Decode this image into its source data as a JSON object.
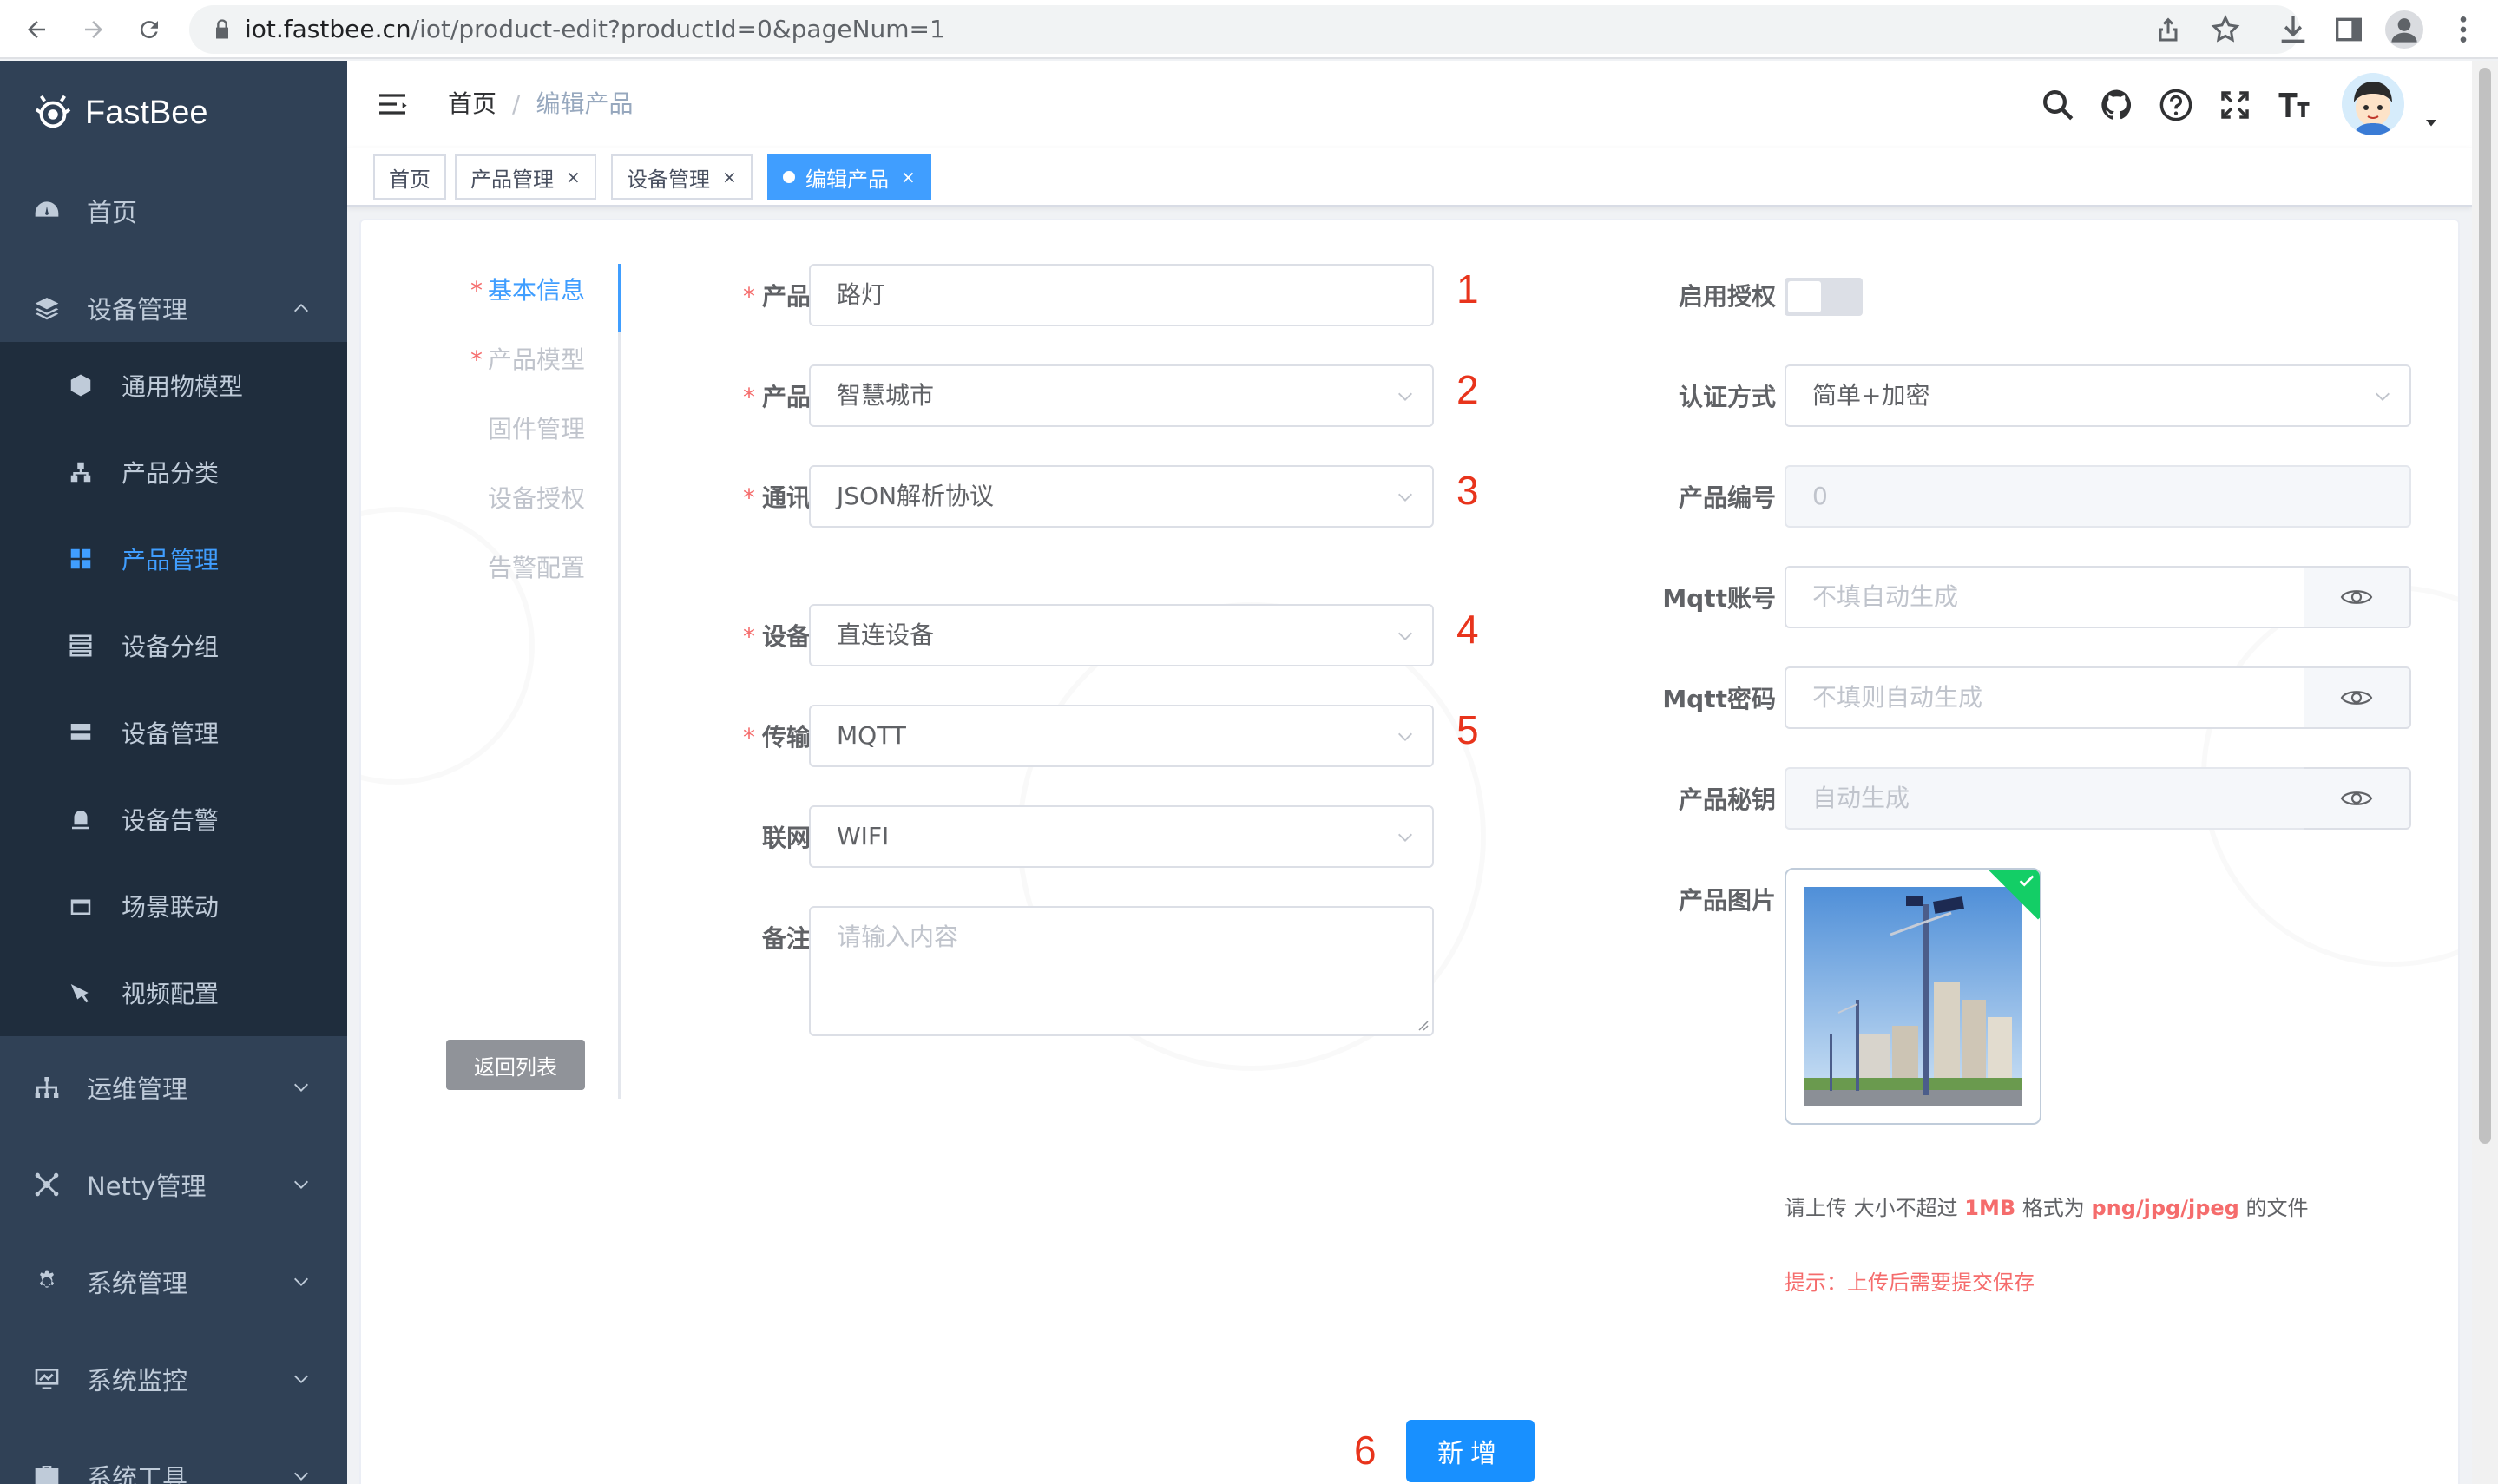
{
  "browser": {
    "url_host": "iot.fastbee.cn",
    "url_path": "/iot/product-edit?productId=0&pageNum=1"
  },
  "app": {
    "logo_text": "FastBee"
  },
  "sidebar": {
    "items": [
      {
        "label": "首页",
        "icon": "dashboard-icon"
      },
      {
        "label": "设备管理",
        "icon": "layers-icon",
        "expanded": true
      },
      {
        "label": "运维管理",
        "icon": "tree-icon"
      },
      {
        "label": "Netty管理",
        "icon": "network-icon"
      },
      {
        "label": "系统管理",
        "icon": "gear-icon"
      },
      {
        "label": "系统监控",
        "icon": "monitor-icon"
      },
      {
        "label": "系统工具",
        "icon": "toolbox-icon"
      }
    ],
    "sub_items": [
      {
        "label": "通用物模型",
        "icon": "cube-icon"
      },
      {
        "label": "产品分类",
        "icon": "hierarchy-icon"
      },
      {
        "label": "产品管理",
        "icon": "grid-icon",
        "active": true
      },
      {
        "label": "设备分组",
        "icon": "group-icon"
      },
      {
        "label": "设备管理",
        "icon": "server-icon"
      },
      {
        "label": "设备告警",
        "icon": "alarm-icon"
      },
      {
        "label": "场景联动",
        "icon": "scene-icon"
      },
      {
        "label": "视频配置",
        "icon": "camera-icon"
      }
    ]
  },
  "header": {
    "breadcrumb": [
      "首页",
      "编辑产品"
    ],
    "separator": "/"
  },
  "tags": [
    {
      "label": "首页"
    },
    {
      "label": "产品管理",
      "close": "×"
    },
    {
      "label": "设备管理",
      "close": "×"
    },
    {
      "label": "编辑产品",
      "close": "×",
      "active": true
    }
  ],
  "steps": [
    {
      "label": "基本信息",
      "required": "*",
      "active": true
    },
    {
      "label": "产品模型",
      "required": "*"
    },
    {
      "label": "固件管理"
    },
    {
      "label": "设备授权"
    },
    {
      "label": "告警配置"
    }
  ],
  "back_button": "返回列表",
  "form_left": {
    "product_name": {
      "label": "产品名称",
      "value": "路灯",
      "marker": "1"
    },
    "category": {
      "label": "产品分类",
      "value": "智慧城市",
      "marker": "2"
    },
    "protocol": {
      "label": "通讯协议",
      "value": "JSON解析协议",
      "marker": "3"
    },
    "device_type": {
      "label": "设备类型",
      "value": "直连设备",
      "marker": "4"
    },
    "transport": {
      "label": "传输协议",
      "value": "MQTT",
      "marker": "5"
    },
    "network": {
      "label": "联网方式",
      "value": "WIFI"
    },
    "remark": {
      "label": "备注信息",
      "placeholder": "请输入内容"
    },
    "required_mark": "*"
  },
  "form_right": {
    "auth_enable": {
      "label": "启用授权",
      "on": false
    },
    "auth_method": {
      "label": "认证方式",
      "value": "简单+加密"
    },
    "product_id": {
      "label": "产品编号",
      "value": "0"
    },
    "mqtt_account": {
      "label": "Mqtt账号",
      "placeholder": "不填自动生成"
    },
    "mqtt_password": {
      "label": "Mqtt密码",
      "placeholder": "不填则自动生成"
    },
    "product_secret": {
      "label": "产品秘钥",
      "placeholder": "自动生成"
    },
    "product_image": {
      "label": "产品图片"
    }
  },
  "upload": {
    "hint_prefix": "请上传 大小不超过",
    "hint_size": "1MB",
    "hint_mid": "格式为",
    "hint_formats": "png/jpg/jpeg",
    "hint_suffix": "的文件",
    "tip": "提示：上传后需要提交保存"
  },
  "submit": {
    "label": "新增",
    "marker": "6"
  },
  "colors": {
    "sidebar_bg": "#304156",
    "submenu_bg": "#1f2d3d",
    "primary": "#409eff",
    "danger": "#f56c6c",
    "annotation": "#e8341c"
  }
}
